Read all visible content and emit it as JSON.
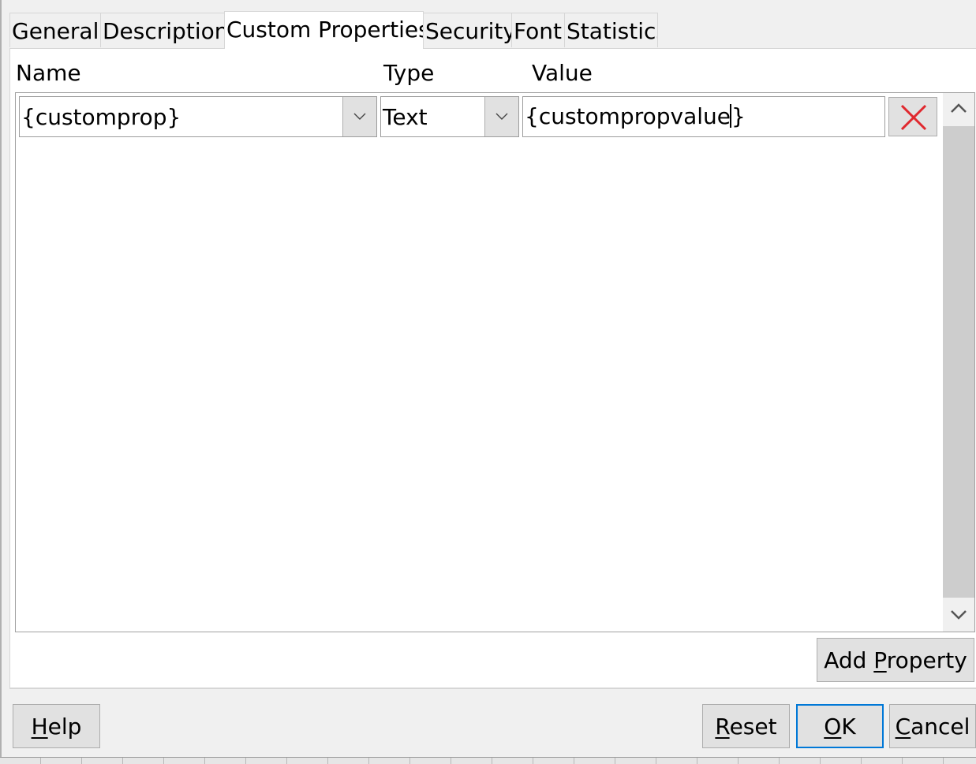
{
  "tabs": [
    {
      "label": "General"
    },
    {
      "label": "Description"
    },
    {
      "label": "Custom Properties",
      "active": true
    },
    {
      "label": "Security"
    },
    {
      "label": "Font"
    },
    {
      "label": "Statistics"
    }
  ],
  "columns": {
    "name": "Name",
    "type": "Type",
    "value": "Value"
  },
  "property_row": {
    "name": "{customprop}",
    "type": "Text",
    "value": "{custompropvalue}",
    "value_before_caret": "{custompropvalue",
    "value_after_caret": "}"
  },
  "buttons": {
    "add_property": {
      "before": "Add ",
      "mnemonic": "P",
      "after": "roperty"
    },
    "help": {
      "before": "",
      "mnemonic": "H",
      "after": "elp"
    },
    "reset": {
      "before": "",
      "mnemonic": "R",
      "after": "eset"
    },
    "ok": {
      "before": "",
      "mnemonic": "O",
      "after": "K"
    },
    "cancel": {
      "before": "",
      "mnemonic": "C",
      "after": "ancel"
    }
  },
  "icons": {
    "dropdown": "chevron-down-icon",
    "delete": "close-icon",
    "scroll_up": "chevron-up-icon",
    "scroll_down": "chevron-down-icon"
  },
  "colors": {
    "delete_icon": "#e0282e",
    "default_button_border": "#0078d7",
    "dialog_bg": "#f0f0f0"
  }
}
